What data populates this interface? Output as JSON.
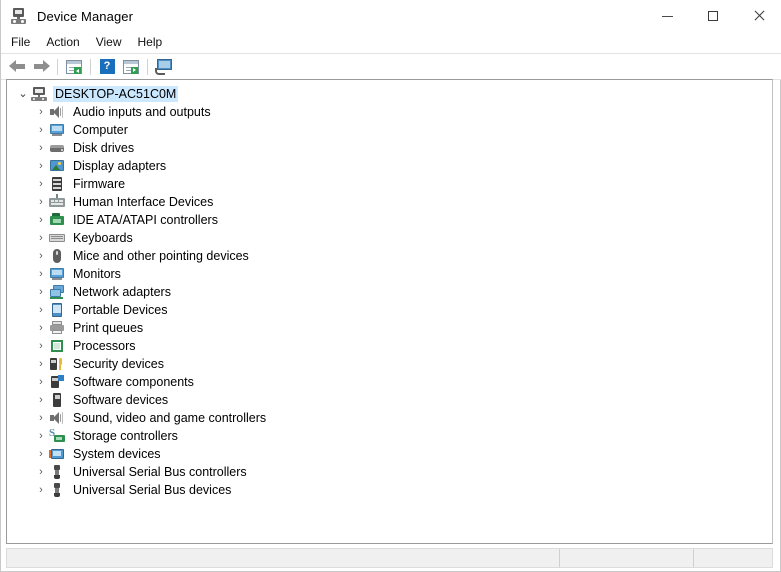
{
  "window": {
    "title": "Device Manager",
    "icon": "device-manager-icon",
    "controls": {
      "minimize": "minimize-icon",
      "maximize": "maximize-icon",
      "close": "close-icon"
    }
  },
  "menubar": {
    "items": [
      {
        "label": "File"
      },
      {
        "label": "Action"
      },
      {
        "label": "View"
      },
      {
        "label": "Help"
      }
    ]
  },
  "toolbar": {
    "buttons": [
      {
        "name": "back-button",
        "icon": "back-arrow-icon"
      },
      {
        "name": "forward-button",
        "icon": "forward-arrow-icon"
      },
      {
        "name": "show-hide-console-tree-button",
        "icon": "console-tree-icon"
      },
      {
        "name": "help-button",
        "icon": "help-question-icon"
      },
      {
        "name": "properties-button",
        "icon": "properties-panel-icon"
      },
      {
        "name": "scan-for-hardware-changes-button",
        "icon": "scan-monitor-icon"
      }
    ]
  },
  "tree": {
    "root": {
      "label": "DESKTOP-AC51C0M",
      "icon": "computer-root-icon",
      "expanded": true,
      "selected": true,
      "chevron": "⌄"
    },
    "chevron_collapsed": "›",
    "items": [
      {
        "label": "Audio inputs and outputs",
        "icon": "speaker-icon"
      },
      {
        "label": "Computer",
        "icon": "monitor-icon"
      },
      {
        "label": "Disk drives",
        "icon": "disk-drive-icon"
      },
      {
        "label": "Display adapters",
        "icon": "display-adapter-icon"
      },
      {
        "label": "Firmware",
        "icon": "firmware-chip-icon"
      },
      {
        "label": "Human Interface Devices",
        "icon": "hid-icon"
      },
      {
        "label": "IDE ATA/ATAPI controllers",
        "icon": "ide-controller-icon"
      },
      {
        "label": "Keyboards",
        "icon": "keyboard-icon"
      },
      {
        "label": "Mice and other pointing devices",
        "icon": "mouse-icon"
      },
      {
        "label": "Monitors",
        "icon": "monitor-icon"
      },
      {
        "label": "Network adapters",
        "icon": "network-adapter-icon"
      },
      {
        "label": "Portable Devices",
        "icon": "portable-device-icon"
      },
      {
        "label": "Print queues",
        "icon": "printer-icon"
      },
      {
        "label": "Processors",
        "icon": "processor-icon"
      },
      {
        "label": "Security devices",
        "icon": "security-device-icon"
      },
      {
        "label": "Software components",
        "icon": "software-component-icon"
      },
      {
        "label": "Software devices",
        "icon": "software-device-icon"
      },
      {
        "label": "Sound, video and game controllers",
        "icon": "speaker-icon"
      },
      {
        "label": "Storage controllers",
        "icon": "storage-controller-icon"
      },
      {
        "label": "System devices",
        "icon": "system-device-icon"
      },
      {
        "label": "Universal Serial Bus controllers",
        "icon": "usb-icon"
      },
      {
        "label": "Universal Serial Bus devices",
        "icon": "usb-icon"
      }
    ]
  },
  "statusbar": {
    "panes": [
      {
        "text": ""
      },
      {
        "text": ""
      },
      {
        "text": ""
      }
    ]
  },
  "colors": {
    "selection": "#cce8ff",
    "window_bg": "#ffffff",
    "statusbar_bg": "#f0f0f0",
    "accent_blue": "#1a6fbd"
  }
}
